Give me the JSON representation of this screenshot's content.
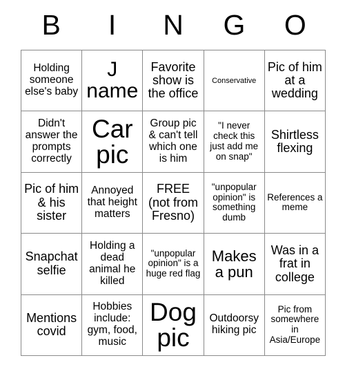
{
  "card": {
    "title_letters": [
      "B",
      "I",
      "N",
      "G",
      "O"
    ],
    "columns": 5,
    "rows": 5,
    "border_color": "#8a8a8a",
    "background_color": "#ffffff",
    "text_color": "#000000",
    "cells": [
      {
        "text": "Holding someone else's baby",
        "size": "m"
      },
      {
        "text": "J name",
        "size": "2xl"
      },
      {
        "text": "Favorite show is the office",
        "size": "l"
      },
      {
        "text": "Conservative",
        "size": "xs"
      },
      {
        "text": "Pic of him at a wedding",
        "size": "l"
      },
      {
        "text": "Didn't answer the prompts correctly",
        "size": "m"
      },
      {
        "text": "Car pic",
        "size": "3xl"
      },
      {
        "text": "Group pic & can't tell which one is him",
        "size": "m"
      },
      {
        "text": "\"I never check this just add me on snap\"",
        "size": "s"
      },
      {
        "text": "Shirtless flexing",
        "size": "l"
      },
      {
        "text": "Pic of him & his sister",
        "size": "l"
      },
      {
        "text": "Annoyed that height matters",
        "size": "m"
      },
      {
        "text": "FREE (not from Fresno)",
        "size": "l"
      },
      {
        "text": "\"unpopular opinion\" is something dumb",
        "size": "s"
      },
      {
        "text": "References a meme",
        "size": "s"
      },
      {
        "text": "Snapchat selfie",
        "size": "l"
      },
      {
        "text": "Holding a dead animal he killed",
        "size": "m"
      },
      {
        "text": "\"unpopular opinion\" is a huge red flag",
        "size": "s"
      },
      {
        "text": "Makes a pun",
        "size": "xl"
      },
      {
        "text": "Was in a frat in college",
        "size": "l"
      },
      {
        "text": "Mentions covid",
        "size": "l"
      },
      {
        "text": "Hobbies include: gym, food, music",
        "size": "m"
      },
      {
        "text": "Dog pic",
        "size": "3xl"
      },
      {
        "text": "Outdoorsy hiking pic",
        "size": "m"
      },
      {
        "text": "Pic from somewhere in Asia/Europe",
        "size": "s"
      }
    ]
  }
}
